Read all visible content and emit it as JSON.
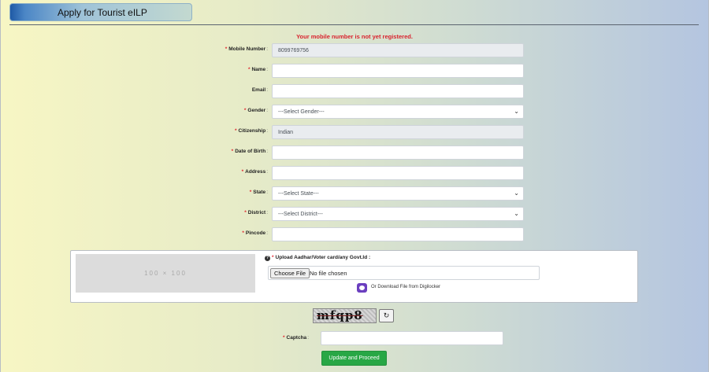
{
  "header": {
    "title": "Apply for Tourist eILP"
  },
  "alert": {
    "message": "Your mobile number is not yet registered."
  },
  "form": {
    "fields": [
      {
        "label": "Mobile Number",
        "required": "*",
        "value": "8099769756",
        "readonly": true,
        "type": "text"
      },
      {
        "label": "Name",
        "required": "*",
        "value": "",
        "type": "text"
      },
      {
        "label": "Email",
        "required": "",
        "value": "",
        "type": "text"
      },
      {
        "label": "Gender",
        "required": "*",
        "value": "---Select Gender---",
        "type": "select"
      },
      {
        "label": "Citizenship",
        "required": "*",
        "value": "Indian",
        "readonly": true,
        "type": "text"
      },
      {
        "label": "Date of Birth",
        "required": "*",
        "value": "",
        "type": "text"
      },
      {
        "label": "Address",
        "required": "*",
        "value": "",
        "type": "text"
      },
      {
        "label": "State",
        "required": "*",
        "value": "---Select State---",
        "type": "select"
      },
      {
        "label": "District",
        "required": "*",
        "value": "---Select District---",
        "type": "select"
      },
      {
        "label": "Pincode",
        "required": "*",
        "value": "",
        "type": "text"
      }
    ],
    "colon": ":",
    "chevron": "⌄"
  },
  "upload": {
    "placeholder_text": "100 × 100",
    "help_glyph": "?",
    "required": "*",
    "label": "Upload Aadhar/Voter card/any Govt.Id :",
    "button_label": "Choose File",
    "file_status": "No file chosen",
    "digilocker_text": "Or Download File from Digilocker"
  },
  "captcha": {
    "image_text": "mfqp8",
    "refresh_glyph": "↻",
    "label": "Captcha",
    "required": "*",
    "colon": ":",
    "value": ""
  },
  "actions": {
    "submit_label": "Update and Proceed"
  },
  "colors": {
    "accent_green": "#28a745",
    "error_red": "#d9232e",
    "header_blue": "#1f5aa6"
  }
}
